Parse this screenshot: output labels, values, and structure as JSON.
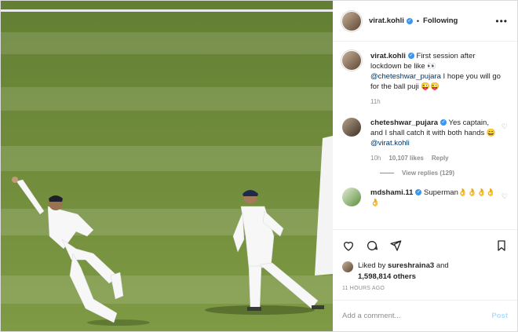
{
  "post": {
    "author": "virat.kohli",
    "follow_label": "Following",
    "dot": "•",
    "more": "•••"
  },
  "caption": {
    "user": "virat.kohli",
    "text": "First session after lockdown be like 👀",
    "mention": "@cheteshwar_pujara",
    "text2": " I hope you will go for the ball puji 😜😜",
    "age": "11h"
  },
  "comments": [
    {
      "user": "cheteshwar_pujara",
      "text": "Yes captain, and I shall catch it with both hands 😄 ",
      "mention": "@virat.kohli",
      "age": "10h",
      "likes": "10,107 likes",
      "reply_label": "Reply",
      "view_replies": "View replies (129)"
    },
    {
      "user": "mdshami.11",
      "text": "Superman👌👌👌👌👌"
    }
  ],
  "likes": {
    "prefix": "Liked by ",
    "user": "sureshraina3",
    "mid": " and",
    "count": "1,598,814 others"
  },
  "timestamp": "11 HOURS AGO",
  "add_comment": {
    "placeholder": "Add a comment...",
    "post_label": "Post"
  },
  "colors": {
    "accent": "#3897f0",
    "post_disabled": "#b2dffc",
    "field": "#6c8a3a"
  }
}
